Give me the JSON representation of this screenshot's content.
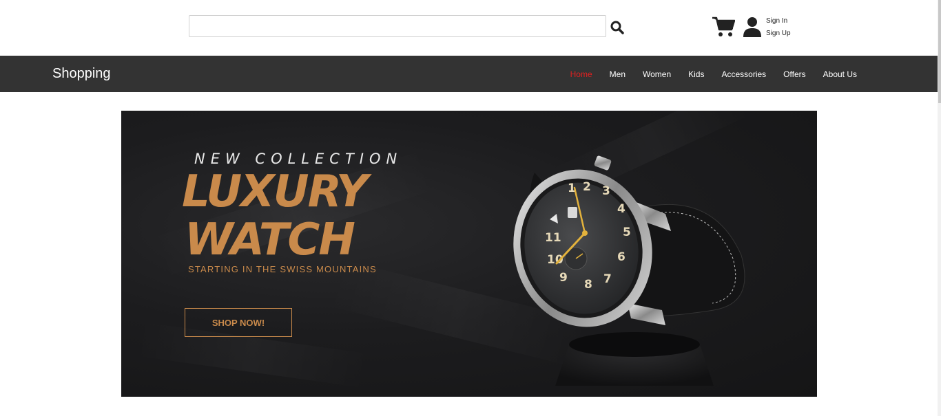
{
  "header": {
    "search": {
      "value": "",
      "placeholder": ""
    },
    "search_icon": "search-icon",
    "cart_icon": "cart-icon",
    "user_icon": "user-icon",
    "sign_in": "Sign In",
    "sign_up": "Sign Up"
  },
  "navbar": {
    "brand": "Shopping",
    "links": [
      {
        "label": "Home",
        "active": true
      },
      {
        "label": "Men"
      },
      {
        "label": "Women"
      },
      {
        "label": "Kids"
      },
      {
        "label": "Accessories"
      },
      {
        "label": "Offers"
      },
      {
        "label": "About Us"
      }
    ],
    "active_color": "#e02020",
    "bg_color": "#333333"
  },
  "banner": {
    "eyebrow": "NEW COLLECTION",
    "headline_line1": "LUXURY",
    "headline_line2": "WATCH",
    "tagline": "STARTING IN THE SWISS MOUNTAINS",
    "cta": "SHOP NOW!",
    "accent_color": "#c98a4b",
    "dial_numbers": [
      "1",
      "2",
      "3",
      "4",
      "5",
      "6",
      "7",
      "8",
      "9",
      "10",
      "11"
    ]
  }
}
